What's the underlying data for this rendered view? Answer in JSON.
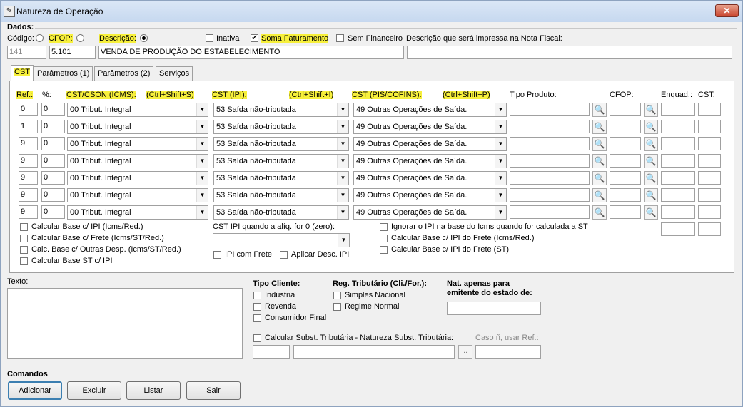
{
  "window": {
    "title": "Natureza de Operação",
    "close_label": "✕"
  },
  "dados": {
    "group_label": "Dados:",
    "codigo_label": "Código:",
    "cfop_label": "CFOP:",
    "descricao_label": "Descrição:",
    "inativa_label": "Inativa",
    "soma_label": "Soma Faturamento",
    "sem_fin_label": "Sem Financeiro",
    "desc_nf_label": "Descrição que será impressa na Nota Fiscal:",
    "codigo_value": "141",
    "cfop_value": "5.101",
    "descricao_value": "VENDA DE PRODUÇÃO DO ESTABELECIMENTO",
    "desc_nf_value": ""
  },
  "tabs": [
    "CST",
    "Parâmetros (1)",
    "Parâmetros (2)",
    "Serviços"
  ],
  "cst_headers": {
    "ref": "Ref.:",
    "pct": "%:",
    "icms": "CST/CSON (ICMS):",
    "icms_key": "(Ctrl+Shift+S)",
    "ipi": "CST (IPI):",
    "ipi_key": "(Ctrl+Shift+I)",
    "pis": "CST (PIS/COFINS):",
    "pis_key": "(Ctrl+Shift+P)",
    "tipo_produto": "Tipo Produto:",
    "cfop": "CFOP:",
    "enquad": "Enquad.:",
    "cst": "CST:"
  },
  "rows": [
    {
      "ref": "0",
      "pct": "0",
      "icms": "00 Tribut. Integral",
      "ipi": "53 Saída não-tributada",
      "pis": "49 Outras Operações de Saída."
    },
    {
      "ref": "1",
      "pct": "0",
      "icms": "00 Tribut. Integral",
      "ipi": "53 Saída não-tributada",
      "pis": "49 Outras Operações de Saída."
    },
    {
      "ref": "9",
      "pct": "0",
      "icms": "00 Tribut. Integral",
      "ipi": "53 Saída não-tributada",
      "pis": "49 Outras Operações de Saída."
    },
    {
      "ref": "9",
      "pct": "0",
      "icms": "00 Tribut. Integral",
      "ipi": "53 Saída não-tributada",
      "pis": "49 Outras Operações de Saída."
    },
    {
      "ref": "9",
      "pct": "0",
      "icms": "00 Tribut. Integral",
      "ipi": "53 Saída não-tributada",
      "pis": "49 Outras Operações de Saída."
    },
    {
      "ref": "9",
      "pct": "0",
      "icms": "00 Tribut. Integral",
      "ipi": "53 Saída não-tributada",
      "pis": "49 Outras Operações de Saída."
    },
    {
      "ref": "9",
      "pct": "0",
      "icms": "00 Tribut. Integral",
      "ipi": "53 Saída não-tributada",
      "pis": "49 Outras Operações de Saída."
    }
  ],
  "cst_options": {
    "calc_ipi": "Calcular Base c/ IPI (Icms/Red.)",
    "calc_frete": "Calcular Base c/ Frete (Icms/ST/Red.)",
    "calc_outras": "Calc. Base c/ Outras Desp. (Icms/ST/Red.)",
    "calc_st_ipi": "Calcular Base ST c/ IPI",
    "cst_ipi_zero_label": "CST IPI quando a alíq. for 0 (zero):",
    "ipi_com_frete": "IPI com Frete",
    "aplicar_desc": "Aplicar Desc. IPI",
    "ignorar_ipi": "Ignorar o IPI na base do Icms quando for calculada a ST",
    "calc_ipi_frete": "Calcular Base c/ IPI do Frete (Icms/Red.)",
    "calc_ipi_frete_st": "Calcular Base c/ IPI do Frete (ST)"
  },
  "texto_label": "Texto:",
  "tipo_cliente": {
    "label": "Tipo Cliente:",
    "items": [
      "Industria",
      "Revenda",
      "Consumidor Final"
    ]
  },
  "reg_trib": {
    "label": "Reg. Tributário (Cli./For.):",
    "items": [
      "Simples Nacional",
      "Regime Normal"
    ]
  },
  "nat_apenas": {
    "line1": "Nat. apenas para",
    "line2": "emitente do estado de:"
  },
  "subst": {
    "label": "Calcular Subst. Tributária - Natureza Subst. Tributária:",
    "caso_label": "Caso ñ, usar Ref.:",
    "ellipsis": ".."
  },
  "comandos": {
    "label": "Comandos",
    "adicionar": "Adicionar",
    "excluir": "Excluir",
    "listar": "Listar",
    "sair": "Sair"
  },
  "colors": {
    "highlight": "#f7f03c",
    "title_bar": "#c6d8ef",
    "close": "#c9452e"
  },
  "icons": {
    "search": "magnifier-icon",
    "check": "✔",
    "arrow": "▼"
  }
}
